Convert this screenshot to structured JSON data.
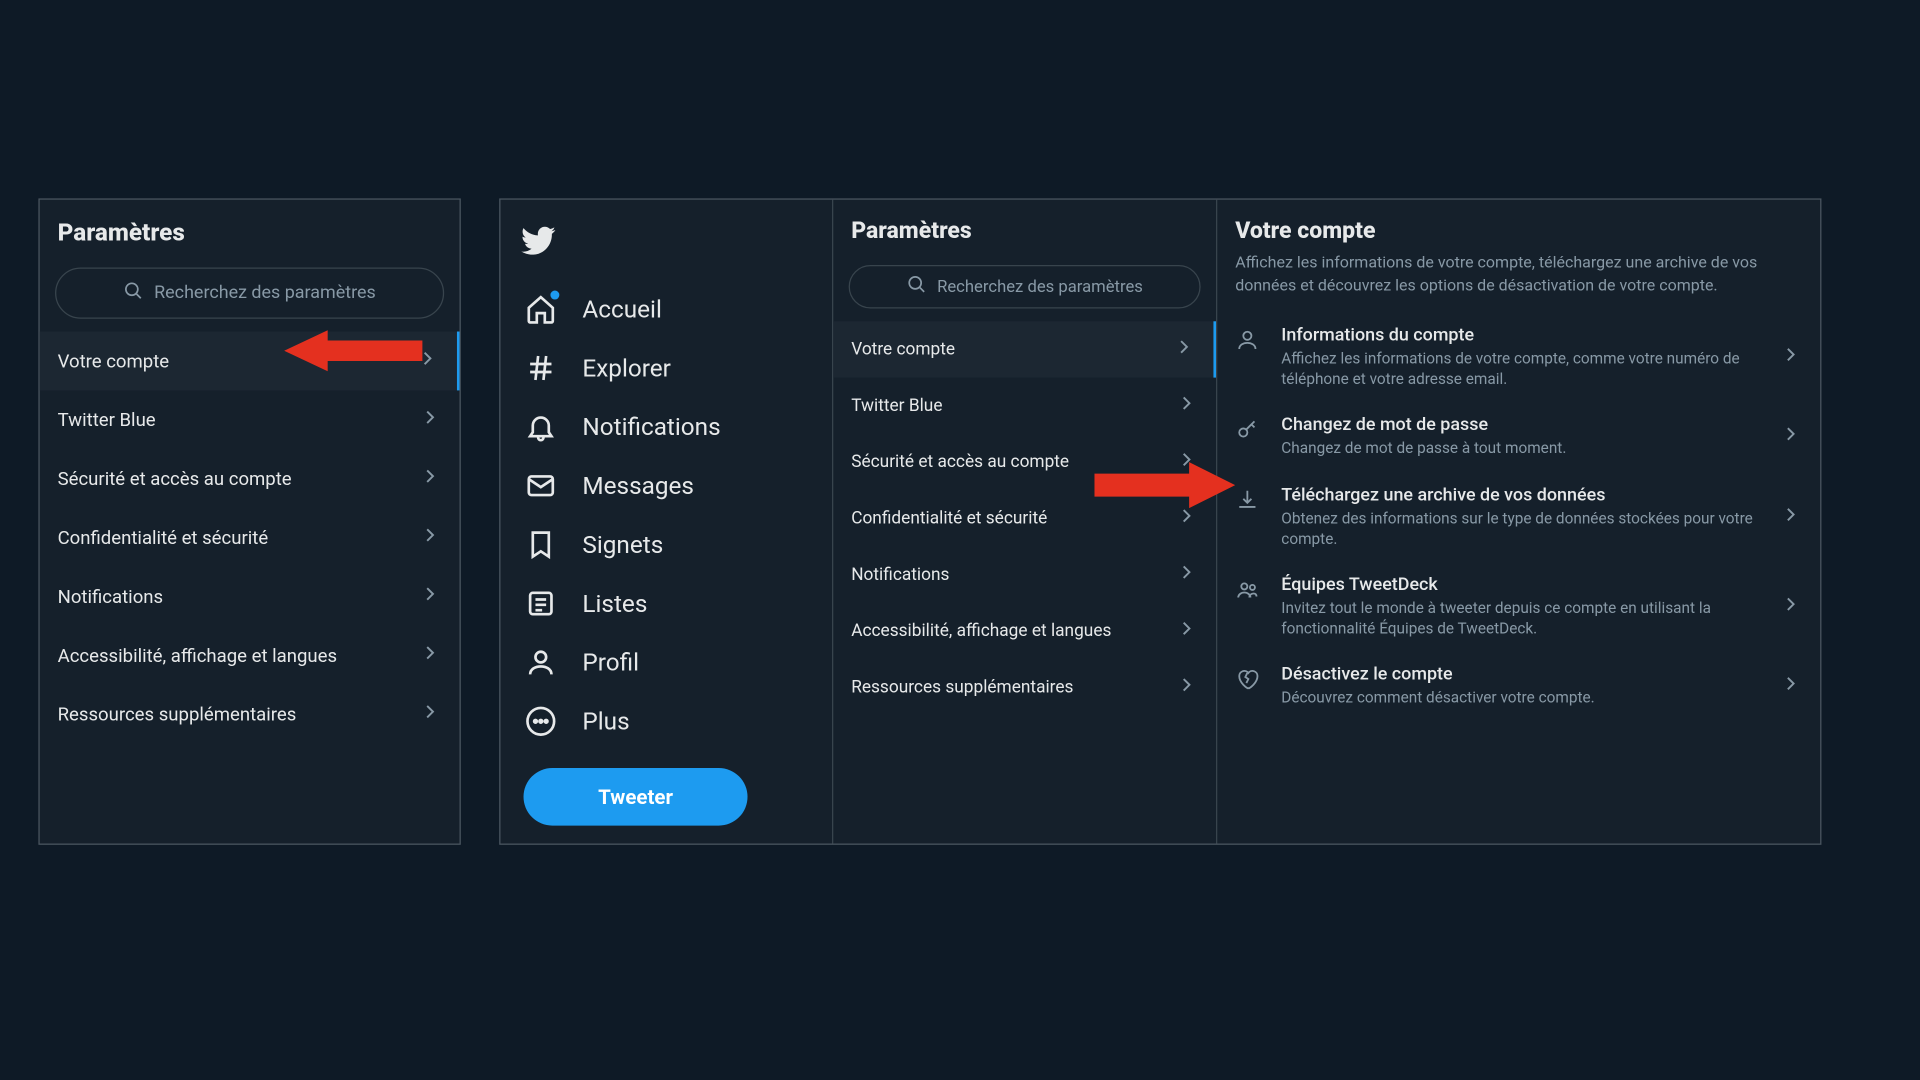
{
  "leftPanel": {
    "title": "Paramètres",
    "searchPlaceholder": "Recherchez des paramètres",
    "items": [
      "Votre compte",
      "Twitter Blue",
      "Sécurité et accès au compte",
      "Confidentialité et sécurité",
      "Notifications",
      "Accessibilité, affichage et langues",
      "Ressources supplémentaires"
    ]
  },
  "nav": {
    "items": [
      "Accueil",
      "Explorer",
      "Notifications",
      "Messages",
      "Signets",
      "Listes",
      "Profil",
      "Plus"
    ],
    "tweetLabel": "Tweeter"
  },
  "midSettings": {
    "title": "Paramètres",
    "searchPlaceholder": "Recherchez des paramètres",
    "items": [
      "Votre compte",
      "Twitter Blue",
      "Sécurité et accès au compte",
      "Confidentialité et sécurité",
      "Notifications",
      "Accessibilité, affichage et langues",
      "Ressources supplémentaires"
    ]
  },
  "detail": {
    "title": "Votre compte",
    "subtitle": "Affichez les informations de votre compte, téléchargez une archive de vos données et découvrez les options de désactivation de votre compte.",
    "options": [
      {
        "title": "Informations du compte",
        "desc": "Affichez les informations de votre compte, comme votre numéro de téléphone et votre adresse email."
      },
      {
        "title": "Changez de mot de passe",
        "desc": "Changez de mot de passe à tout moment."
      },
      {
        "title": "Téléchargez une archive de vos données",
        "desc": "Obtenez des informations sur le type de données stockées pour votre compte."
      },
      {
        "title": "Équipes TweetDeck",
        "desc": "Invitez tout le monde à tweeter depuis ce compte en utilisant la fonctionnalité Équipes de TweetDeck."
      },
      {
        "title": "Désactivez le compte",
        "desc": "Découvrez comment désactiver votre compte."
      }
    ]
  }
}
